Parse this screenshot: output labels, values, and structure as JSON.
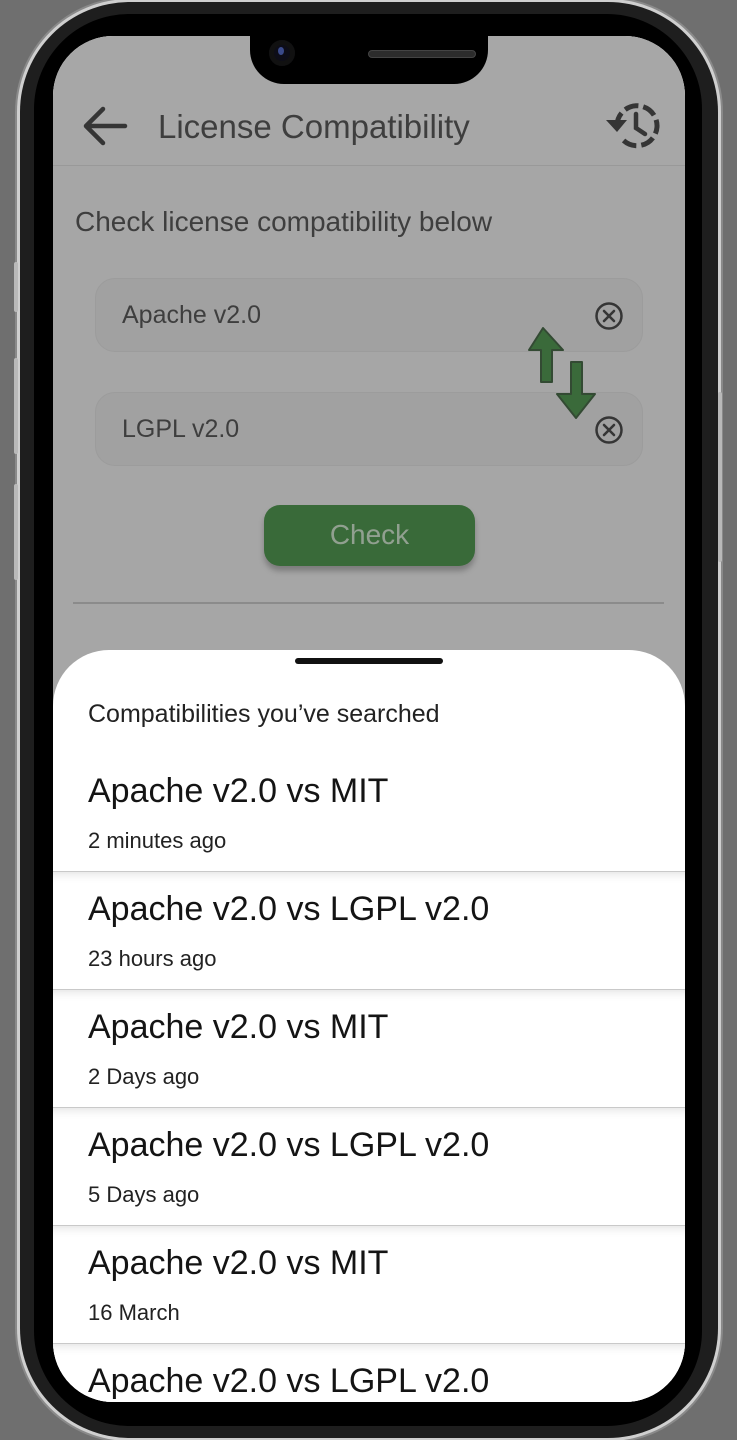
{
  "app_bar": {
    "title": "License Compatibility",
    "back_icon": "arrow-left-icon",
    "history_icon": "history-icon"
  },
  "form": {
    "instruction": "Check license compatibility below",
    "license_one": "Apache v2.0",
    "license_two": "LGPL v2.0",
    "check_label": "Check",
    "swap_icon": "swap-arrows-icon",
    "accent_color": "#197a19"
  },
  "history_sheet": {
    "title": "Compatibilities you’ve searched",
    "items": [
      {
        "title": "Apache v2.0 vs MIT",
        "time": "2 minutes ago"
      },
      {
        "title": "Apache v2.0 vs LGPL v2.0",
        "time": "23 hours ago"
      },
      {
        "title": "Apache v2.0 vs MIT",
        "time": "2 Days ago"
      },
      {
        "title": "Apache v2.0 vs LGPL v2.0",
        "time": "5 Days ago"
      },
      {
        "title": "Apache v2.0 vs MIT",
        "time": "16 March"
      },
      {
        "title": "Apache v2.0 vs LGPL v2.0",
        "time": ""
      }
    ]
  }
}
